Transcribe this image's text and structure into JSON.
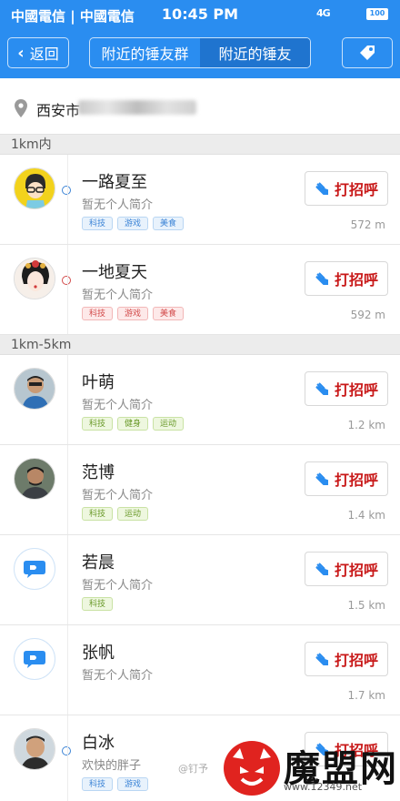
{
  "status_bar": {
    "carrier": "中國電信 | 中國電信",
    "time": "10:45 PM",
    "signal": "4G",
    "battery": "100"
  },
  "nav": {
    "back_label": "返回",
    "tabs": [
      "附近的锤友群",
      "附近的锤友"
    ],
    "active_tab": 1
  },
  "location": {
    "address": "西安市"
  },
  "sections": {
    "near": "1km内",
    "far": "1km-5km"
  },
  "greet_label": "打招呼",
  "users": [
    {
      "name": "一路夏至",
      "bio": "暂无个人简介",
      "tags": [
        "科技",
        "游戏",
        "美食"
      ],
      "distance": "572 m"
    },
    {
      "name": "一地夏天",
      "bio": "暂无个人简介",
      "tags": [
        "科技",
        "游戏",
        "美食"
      ],
      "distance": "592 m"
    },
    {
      "name": "叶萌",
      "bio": "暂无个人简介",
      "tags": [
        "科技",
        "健身",
        "运动"
      ],
      "distance": "1.2 km"
    },
    {
      "name": "范博",
      "bio": "暂无个人简介",
      "tags": [
        "科技",
        "运动"
      ],
      "distance": "1.4 km"
    },
    {
      "name": "若晨",
      "bio": "暂无个人简介",
      "tags": [
        "科技"
      ],
      "distance": "1.5 km"
    },
    {
      "name": "张帆",
      "bio": "暂无个人简介",
      "tags": [],
      "distance": "1.7 km"
    },
    {
      "name": "白冰",
      "bio": "欢快的胖子",
      "tags": [
        "科技",
        "游戏"
      ],
      "distance": ""
    }
  ],
  "watermark": {
    "title": "魔盟网",
    "url": "www.12349.net",
    "weibo": "@钉予"
  },
  "colors": {
    "nav_bg": "#2a8df0",
    "active_tab": "#1f74cf",
    "greet_text": "#c81818"
  }
}
